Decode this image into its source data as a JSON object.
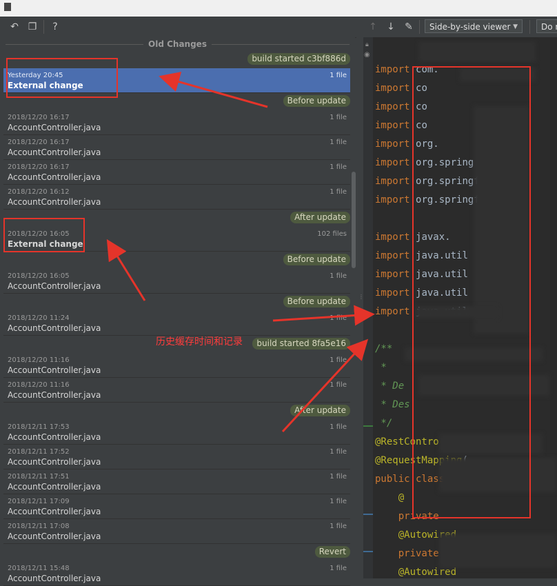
{
  "toolbar": {
    "icons": [
      "revert-icon",
      "copy-icon",
      "help-icon",
      "prev-diff-icon",
      "next-diff-icon",
      "edit-icon"
    ],
    "viewer_mode": "Side-by-side viewer",
    "second_select": "Do n"
  },
  "history": {
    "title": "Old Changes",
    "entries": [
      {
        "type": "label",
        "text": "build started c3bf886d"
      },
      {
        "type": "item",
        "date": "Yesterday 20:45",
        "name": "External change",
        "files": "1 file",
        "bold": true,
        "selected": true
      },
      {
        "type": "label",
        "text": "Before update"
      },
      {
        "type": "item",
        "date": "2018/12/20 16:17",
        "name": "AccountController.java",
        "files": "1 file"
      },
      {
        "type": "item",
        "date": "2018/12/20 16:17",
        "name": "AccountController.java",
        "files": "1 file"
      },
      {
        "type": "item",
        "date": "2018/12/20 16:17",
        "name": "AccountController.java",
        "files": "1 file"
      },
      {
        "type": "item",
        "date": "2018/12/20 16:12",
        "name": "AccountController.java",
        "files": "1 file"
      },
      {
        "type": "label",
        "text": "After update"
      },
      {
        "type": "item",
        "date": "2018/12/20 16:05",
        "name": "External change",
        "files": "102 files",
        "bold": true
      },
      {
        "type": "label",
        "text": "Before update"
      },
      {
        "type": "item",
        "date": "2018/12/20 16:05",
        "name": "AccountController.java",
        "files": "1 file"
      },
      {
        "type": "label",
        "text": "Before update"
      },
      {
        "type": "item",
        "date": "2018/12/20 11:24",
        "name": "AccountController.java",
        "files": "1 file"
      },
      {
        "type": "label",
        "text": "build started 8fa5e16"
      },
      {
        "type": "item",
        "date": "2018/12/20 11:16",
        "name": "AccountController.java",
        "files": "1 file"
      },
      {
        "type": "item",
        "date": "2018/12/20 11:16",
        "name": "AccountController.java",
        "files": "1 file"
      },
      {
        "type": "label",
        "text": "After update"
      },
      {
        "type": "item",
        "date": "2018/12/11 17:53",
        "name": "AccountController.java",
        "files": "1 file"
      },
      {
        "type": "item",
        "date": "2018/12/11 17:52",
        "name": "AccountController.java",
        "files": "1 file"
      },
      {
        "type": "item",
        "date": "2018/12/11 17:51",
        "name": "AccountController.java",
        "files": "1 file"
      },
      {
        "type": "item",
        "date": "2018/12/11 17:09",
        "name": "AccountController.java",
        "files": "1 file"
      },
      {
        "type": "item",
        "date": "2018/12/11 17:08",
        "name": "AccountController.java",
        "files": "1 file"
      },
      {
        "type": "label",
        "text": "Revert"
      },
      {
        "type": "item",
        "date": "2018/12/11 15:48",
        "name": "AccountController.java",
        "files": "1 file"
      }
    ]
  },
  "annotation": "历史缓存时间和记录",
  "editor": {
    "lines": [
      [
        {
          "c": "kw",
          "t": "import "
        },
        {
          "c": "pl",
          "t": "com."
        }
      ],
      [
        {
          "c": "kw",
          "t": "import "
        },
        {
          "c": "pl",
          "t": "co"
        }
      ],
      [
        {
          "c": "kw",
          "t": "import "
        },
        {
          "c": "pl",
          "t": "co"
        }
      ],
      [
        {
          "c": "kw",
          "t": "import "
        },
        {
          "c": "pl",
          "t": "co"
        }
      ],
      [
        {
          "c": "kw",
          "t": "import "
        },
        {
          "c": "pl",
          "t": "org."
        }
      ],
      [
        {
          "c": "kw",
          "t": "import "
        },
        {
          "c": "pl",
          "t": "org.spring"
        }
      ],
      [
        {
          "c": "kw",
          "t": "import "
        },
        {
          "c": "pl",
          "t": "org.springf"
        }
      ],
      [
        {
          "c": "kw",
          "t": "import "
        },
        {
          "c": "pl",
          "t": "org.springf"
        }
      ],
      [],
      [
        {
          "c": "kw",
          "t": "import "
        },
        {
          "c": "pl",
          "t": "javax."
        }
      ],
      [
        {
          "c": "kw",
          "t": "import "
        },
        {
          "c": "pl",
          "t": "java.util"
        }
      ],
      [
        {
          "c": "kw",
          "t": "import "
        },
        {
          "c": "pl",
          "t": "java.util"
        }
      ],
      [
        {
          "c": "kw",
          "t": "import "
        },
        {
          "c": "pl",
          "t": "java.util"
        }
      ],
      [
        {
          "c": "kw",
          "t": "import "
        },
        {
          "c": "pl",
          "t": "java.util"
        }
      ],
      [],
      [
        {
          "c": "cm",
          "t": "/**"
        }
      ],
      [
        {
          "c": "cm",
          "t": " *"
        }
      ],
      [
        {
          "c": "cm",
          "t": " * De"
        }
      ],
      [
        {
          "c": "cm",
          "t": " * Des"
        }
      ],
      [
        {
          "c": "cm",
          "t": " */"
        }
      ],
      [
        {
          "c": "an",
          "t": "@RestContro"
        }
      ],
      [
        {
          "c": "an",
          "t": "@RequestMapping"
        },
        {
          "c": "pl",
          "t": "("
        }
      ],
      [
        {
          "c": "kw",
          "t": "public class"
        }
      ],
      [
        {
          "c": "pl",
          "t": "    "
        },
        {
          "c": "an",
          "t": "@"
        }
      ],
      [
        {
          "c": "pl",
          "t": "    "
        },
        {
          "c": "kw",
          "t": "private "
        }
      ],
      [
        {
          "c": "pl",
          "t": "    "
        },
        {
          "c": "an",
          "t": "@Autowired"
        }
      ],
      [
        {
          "c": "pl",
          "t": "    "
        },
        {
          "c": "kw",
          "t": "private "
        }
      ],
      [
        {
          "c": "pl",
          "t": "    "
        },
        {
          "c": "an",
          "t": "@Autowired"
        }
      ]
    ]
  }
}
